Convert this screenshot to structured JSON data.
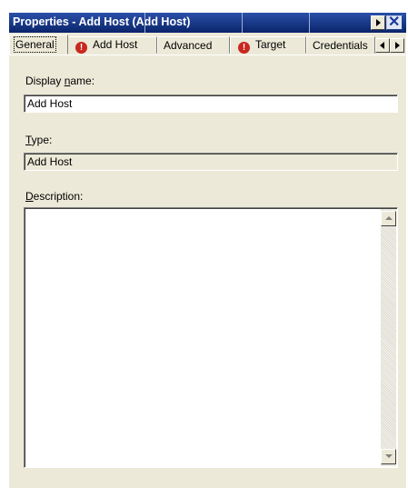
{
  "window": {
    "title": "Properties - Add Host (Add Host)"
  },
  "tabs": [
    {
      "label": "General",
      "warning": false,
      "selected": true
    },
    {
      "label": "Add Host",
      "warning": true,
      "selected": false
    },
    {
      "label": "Advanced",
      "warning": false,
      "selected": false
    },
    {
      "label": "Target",
      "warning": true,
      "selected": false
    },
    {
      "label": "Credentials",
      "warning": false,
      "selected": false
    }
  ],
  "form": {
    "display_name": {
      "label_pre": "Display ",
      "label_accel": "n",
      "label_post": "ame:",
      "value": "Add Host"
    },
    "type": {
      "label_accel": "T",
      "label_post": "ype:",
      "value": "Add Host"
    },
    "description": {
      "label_accel": "D",
      "label_post": "escription:",
      "value": ""
    }
  },
  "icons": {
    "warning": "warning-icon",
    "menu": "menu-arrow-icon",
    "close": "close-icon"
  }
}
